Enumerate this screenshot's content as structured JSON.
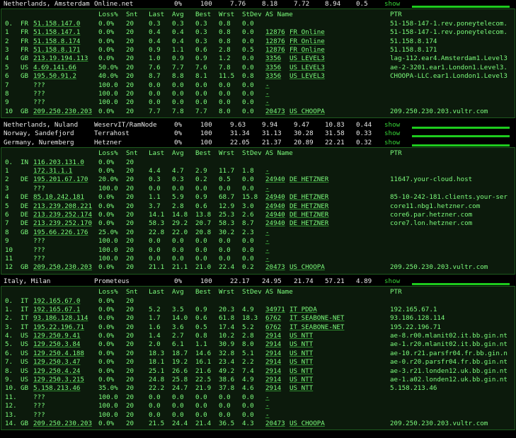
{
  "header": [
    "",
    "Loss%",
    "Snt",
    "Last",
    "Avg",
    "Best",
    "Wrst",
    "StDev",
    "AS Name",
    "PTR"
  ],
  "show_label": "show",
  "groups": [
    {
      "summaries": [
        [
          "Netherlands, Amsterdam",
          "Online.net",
          "0%",
          "100",
          "7.76",
          "8.18",
          "7.72",
          "8.94",
          "0.5"
        ]
      ],
      "hops": [
        [
          "0.",
          "FR",
          "51.158.147.0",
          "0.0%",
          "20",
          "0.3",
          "0.3",
          "0.3",
          "0.8",
          "0.0",
          "",
          "",
          "51-158-147-1.rev.poneytelecom."
        ],
        [
          "1",
          "FR",
          "51.158.147.1",
          "0.0%",
          "20",
          "0.4",
          "0.4",
          "0.3",
          "0.8",
          "0.0",
          "12876",
          "FR Online",
          "51-158-147-1.rev.poneytelecom."
        ],
        [
          "2",
          "FR",
          "51.158.8.174",
          "0.0%",
          "20",
          "0.4",
          "0.4",
          "0.3",
          "0.8",
          "0.0",
          "12876",
          "FR Online",
          "51.158.8.174"
        ],
        [
          "3",
          "FR",
          "51.158.8.171",
          "0.0%",
          "20",
          "0.9",
          "1.1",
          "0.6",
          "2.8",
          "0.5",
          "12876",
          "FR Online",
          "51.158.8.171"
        ],
        [
          "4",
          "GB",
          "213.19.194.113",
          "0.0%",
          "20",
          "1.0",
          "0.9",
          "0.9",
          "1.2",
          "0.0",
          "3356",
          "US LEVEL3",
          "lag-112.ear4.Amsterdam1.Level3"
        ],
        [
          "5",
          "US",
          "4.69.141.66",
          "50.0%",
          "20",
          "7.6",
          "7.7",
          "7.6",
          "7.8",
          "0.0",
          "3356",
          "US LEVEL3",
          "ae-2-3201.ear1.London1.Level3."
        ],
        [
          "6",
          "GB",
          "195.50.91.2",
          "40.0%",
          "20",
          "8.7",
          "8.8",
          "8.1",
          "11.5",
          "0.8",
          "3356",
          "US LEVEL3",
          "CHOOPA-LLC.ear1.London1.Level3"
        ],
        [
          "7",
          "",
          "???",
          "100.0",
          "20",
          "0.0",
          "0.0",
          "0.0",
          "0.0",
          "0.0",
          "-",
          "",
          ""
        ],
        [
          "8",
          "",
          "???",
          "100.0",
          "20",
          "0.0",
          "0.0",
          "0.0",
          "0.0",
          "0.0",
          "-",
          "",
          ""
        ],
        [
          "9",
          "",
          "???",
          "100.0",
          "20",
          "0.0",
          "0.0",
          "0.0",
          "0.0",
          "0.0",
          "-",
          "",
          ""
        ],
        [
          "10",
          "GB",
          "209.250.230.203",
          "0.0%",
          "20",
          "7.7",
          "7.8",
          "7.7",
          "8.0",
          "0.0",
          "20473",
          "US CHOOPA",
          "209.250.230.203.vultr.com"
        ]
      ]
    },
    {
      "summaries": [
        [
          "Netherlands, Nuland",
          "WeservIT/RamNode",
          "0%",
          "100",
          "9.63",
          "9.94",
          "9.47",
          "10.83",
          "0.44"
        ],
        [
          "Norway, Sandefjord",
          "Terrahost",
          "0%",
          "100",
          "31.34",
          "31.13",
          "30.28",
          "31.58",
          "0.33"
        ],
        [
          "Germany, Nuremberg",
          "Hetzner",
          "0%",
          "100",
          "22.05",
          "21.37",
          "20.89",
          "22.21",
          "0.32"
        ]
      ],
      "hops": [
        [
          "0.",
          "IN",
          "116.203.131.0",
          "0.0%",
          "20",
          "",
          "",
          "",
          "",
          "",
          "",
          "",
          ""
        ],
        [
          "1",
          "",
          "172.31.1.1",
          "0.0%",
          "20",
          "4.4",
          "4.7",
          "2.9",
          "11.7",
          "1.8",
          "-",
          "",
          ""
        ],
        [
          "2",
          "DE",
          "195.201.67.170",
          "20.0%",
          "20",
          "0.3",
          "0.3",
          "0.2",
          "0.5",
          "0.0",
          "24940",
          "DE HETZNER",
          "11647.your-cloud.host"
        ],
        [
          "3",
          "",
          "???",
          "100.0",
          "20",
          "0.0",
          "0.0",
          "0.0",
          "0.0",
          "0.0",
          "-",
          "",
          ""
        ],
        [
          "4",
          "DE",
          "85.10.242.181",
          "0.0%",
          "20",
          "1.1",
          "5.9",
          "0.9",
          "68.7",
          "15.8",
          "24940",
          "DE HETZNER",
          "85-10-242-181.clients.your-ser"
        ],
        [
          "5",
          "DE",
          "213.239.208.221",
          "0.0%",
          "20",
          "3.7",
          "2.8",
          "0.6",
          "12.9",
          "3.0",
          "24940",
          "DE HETZNER",
          "core11.nbg1.hetzner.com"
        ],
        [
          "6",
          "DE",
          "213.239.252.174",
          "0.0%",
          "20",
          "14.1",
          "14.8",
          "13.8",
          "25.3",
          "2.6",
          "24940",
          "DE HETZNER",
          "core6.par.hetzner.com"
        ],
        [
          "7",
          "DE",
          "213.239.252.170",
          "0.0%",
          "20",
          "58.3",
          "29.2",
          "20.7",
          "58.3",
          "8.7",
          "24940",
          "DE HETZNER",
          "core7.lon.hetzner.com"
        ],
        [
          "8",
          "GB",
          "195.66.226.176",
          "25.0%",
          "20",
          "22.8",
          "22.0",
          "20.8",
          "30.2",
          "2.3",
          "-",
          "",
          ""
        ],
        [
          "9",
          "",
          "???",
          "100.0",
          "20",
          "0.0",
          "0.0",
          "0.0",
          "0.0",
          "0.0",
          "-",
          "",
          ""
        ],
        [
          "10",
          "",
          "???",
          "100.0",
          "20",
          "0.0",
          "0.0",
          "0.0",
          "0.0",
          "0.0",
          "-",
          "",
          ""
        ],
        [
          "11",
          "",
          "???",
          "100.0",
          "20",
          "0.0",
          "0.0",
          "0.0",
          "0.0",
          "0.0",
          "-",
          "",
          ""
        ],
        [
          "12",
          "GB",
          "209.250.230.203",
          "0.0%",
          "20",
          "21.1",
          "21.1",
          "21.0",
          "22.4",
          "0.2",
          "20473",
          "US CHOOPA",
          "209.250.230.203.vultr.com"
        ]
      ]
    },
    {
      "summaries": [
        [
          "Italy, Milan",
          "Prometeus",
          "0%",
          "100",
          "22.17",
          "24.95",
          "21.74",
          "57.21",
          "4.89"
        ]
      ],
      "hops": [
        [
          "0.",
          "IT",
          "192.165.67.0",
          "0.0%",
          "20",
          "",
          "",
          "",
          "",
          "",
          "",
          "",
          ""
        ],
        [
          "1.",
          "IT",
          "192.165.67.1",
          "0.0%",
          "20",
          "5.2",
          "3.5",
          "0.9",
          "20.3",
          "4.9",
          "34971",
          "IT PDDA",
          "192.165.67.1"
        ],
        [
          "2.",
          "IT",
          "93.186.128.114",
          "0.0%",
          "20",
          "1.7",
          "14.0",
          "0.6",
          "61.8",
          "18.3",
          "6762",
          "IT SEABONE-NET",
          "93.186.128.114"
        ],
        [
          "3.",
          "IT",
          "195.22.196.71",
          "0.0%",
          "20",
          "1.6",
          "3.6",
          "0.5",
          "17.4",
          "5.2",
          "6762",
          "IT SEABONE-NET",
          "195.22.196.71"
        ],
        [
          "4.",
          "US",
          "129.250.9.41",
          "0.0%",
          "20",
          "1.4",
          "2.7",
          "0.8",
          "10.2",
          "2.8",
          "2914",
          "US NTT",
          "ae-8.r00.mlanit02.it.bb.gin.nt"
        ],
        [
          "5.",
          "US",
          "129.250.3.84",
          "0.0%",
          "20",
          "2.0",
          "6.1",
          "1.1",
          "30.9",
          "8.0",
          "2914",
          "US NTT",
          "ae-1.r20.mlanit02.it.bb.gin.nt"
        ],
        [
          "6.",
          "US",
          "129.250.4.188",
          "0.0%",
          "20",
          "18.3",
          "18.7",
          "14.6",
          "32.8",
          "5.1",
          "2914",
          "US NTT",
          "ae-10.r21.parsfr04.fr.bb.gin.n"
        ],
        [
          "7.",
          "US",
          "129.250.3.47",
          "0.0%",
          "20",
          "18.1",
          "19.2",
          "16.1",
          "23.4",
          "2.2",
          "2914",
          "US NTT",
          "ae-0.r20.parsfr04.fr.bb.gin.nt"
        ],
        [
          "8.",
          "US",
          "129.250.4.24",
          "0.0%",
          "20",
          "25.1",
          "26.6",
          "21.6",
          "49.2",
          "7.4",
          "2914",
          "US NTT",
          "ae-3.r21.londen12.uk.bb.gin.nt"
        ],
        [
          "9.",
          "US",
          "129.250.3.215",
          "0.0%",
          "20",
          "24.8",
          "25.8",
          "22.5",
          "38.6",
          "4.9",
          "2914",
          "US NTT",
          "ae-1.a02.londen12.uk.bb.gin.nt"
        ],
        [
          "10.",
          "GB",
          "5.158.213.46",
          "35.0%",
          "20",
          "22.2",
          "24.7",
          "21.9",
          "37.8",
          "4.6",
          "2914",
          "US NTT",
          "5.158.213.46"
        ],
        [
          "11.",
          "",
          "???",
          "100.0",
          "20",
          "0.0",
          "0.0",
          "0.0",
          "0.0",
          "0.0",
          "-",
          "",
          ""
        ],
        [
          "12.",
          "",
          "???",
          "100.0",
          "20",
          "0.0",
          "0.0",
          "0.0",
          "0.0",
          "0.0",
          "-",
          "",
          ""
        ],
        [
          "13.",
          "",
          "???",
          "100.0",
          "20",
          "0.0",
          "0.0",
          "0.0",
          "0.0",
          "0.0",
          "-",
          "",
          ""
        ],
        [
          "14.",
          "GB",
          "209.250.230.203",
          "0.0%",
          "20",
          "21.5",
          "24.4",
          "21.4",
          "36.5",
          "4.3",
          "20473",
          "US CHOOPA",
          "209.250.230.203.vultr.com"
        ]
      ]
    }
  ]
}
